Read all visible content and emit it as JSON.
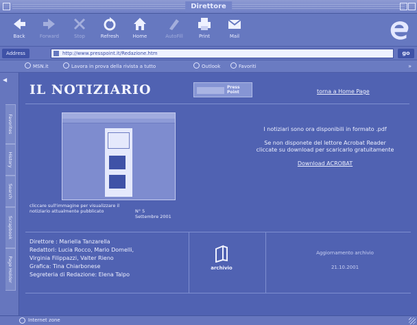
{
  "window": {
    "title": "Direttore"
  },
  "toolbar": {
    "buttons": [
      {
        "label": "Back",
        "icon": "back-arrow-icon",
        "enabled": true
      },
      {
        "label": "Forward",
        "icon": "forward-arrow-icon",
        "enabled": false
      },
      {
        "label": "Stop",
        "icon": "stop-icon",
        "enabled": false
      },
      {
        "label": "Refresh",
        "icon": "refresh-icon",
        "enabled": true
      },
      {
        "label": "Home",
        "icon": "home-icon",
        "enabled": true
      },
      {
        "label": "AutoFill",
        "icon": "autofill-icon",
        "enabled": false
      },
      {
        "label": "Print",
        "icon": "print-icon",
        "enabled": true
      },
      {
        "label": "Mail",
        "icon": "mail-icon",
        "enabled": true
      }
    ],
    "logo": "internet-explorer-e-icon"
  },
  "address": {
    "label": "Address",
    "url": "http://www.presspoint.it/Redazione.htm",
    "go_label": "go"
  },
  "favorites": {
    "items": [
      "MSN.it",
      "Lavora in prova della rivista a tutto",
      "Outlook",
      "Favoriti"
    ],
    "more": "»"
  },
  "explorer_bar": {
    "tabs": [
      "Favorites",
      "History",
      "Search",
      "Scrapbook",
      "Page Holder"
    ]
  },
  "page": {
    "title": "IL NOTIZIARIO",
    "banner_text": "Press Point",
    "home_link": "torna a Home Page",
    "thumb_caption": "cliccare sull'immagine per visualizzare il notiziario attualmente pubblicato",
    "issue_number": "N° 5",
    "issue_date": "Settembre 2001",
    "pdf_note": "I notiziari sono ora disponibili in formato .pdf",
    "acrobat_note": "Se non disponete del lettore Acrobat Reader cliccate su download per scaricarlo gratuitamente",
    "acrobat_link": "Download ACROBAT",
    "credits": [
      "Direttore : Mariella Tanzarella",
      "Redattori: Lucia Rocco, Mario Domelli,",
      "Virginia Filippazzi, Valter Rieno",
      "Grafica: Tina Chiarbonese",
      "Segreteria di Redazione: Elena Talpo"
    ],
    "archive_label": "archivio",
    "update_label": "Aggiornamento archivio",
    "update_date": "21.10.2001"
  },
  "status": {
    "text": "Internet zone"
  },
  "colors": {
    "background": "#5466b4",
    "content": "#5062b2",
    "chrome": "#6678c0",
    "text": "#ffffff"
  }
}
